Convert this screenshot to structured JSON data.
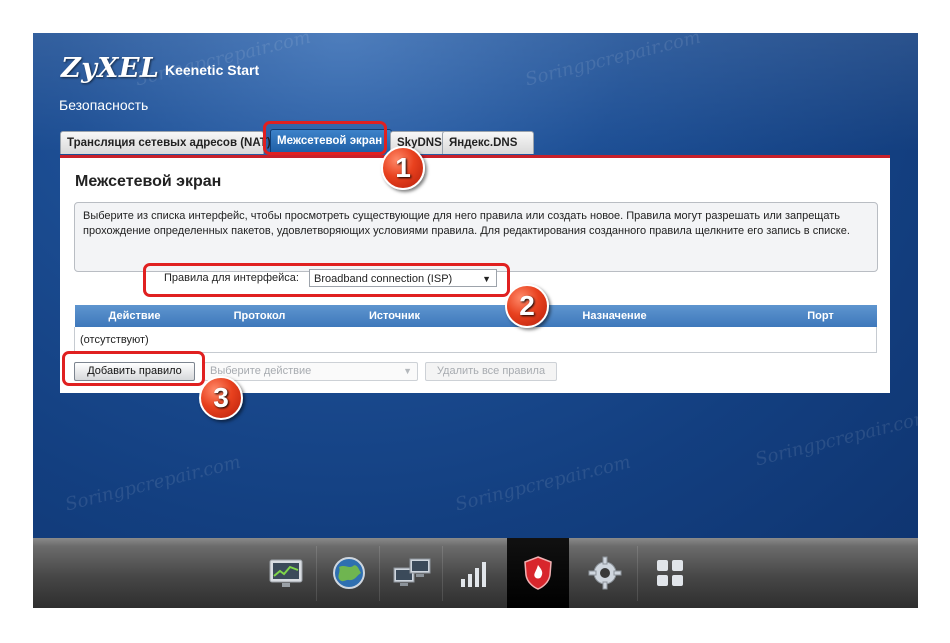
{
  "header": {
    "logo": "ZyXEL",
    "product": "Keenetic Start",
    "section_title": "Безопасность"
  },
  "tabs": [
    {
      "label": "Трансляция сетевых адресов (NAT)",
      "active": false
    },
    {
      "label": "Межсетевой экран",
      "active": true
    },
    {
      "label": "SkyDNS",
      "active": false
    },
    {
      "label": "Яндекс.DNS",
      "active": false
    }
  ],
  "panel": {
    "title": "Межсетевой экран",
    "info": "Выберите из списка интерфейс, чтобы просмотреть существующие для него правила или создать новое. Правила могут разрешать или запрещать прохождение определенных пакетов, удовлетворяющих условиями правила. Для редактирования созданного правила щелкните его запись в списке.",
    "interface_label": "Правила для интерфейса:",
    "interface_value": "Broadband connection (ISP)",
    "table": {
      "columns": [
        "Действие",
        "Протокол",
        "Источник",
        "Назначение",
        "Порт"
      ],
      "empty_text": "(отсутствуют)"
    },
    "add_button": "Добавить правило",
    "action_placeholder": "Выберите действие",
    "delete_all_button": "Удалить все правила"
  },
  "callouts": [
    "1",
    "2",
    "3"
  ],
  "dock": [
    {
      "icon": "monitor-chart-icon",
      "active": false
    },
    {
      "icon": "globe-icon",
      "active": false
    },
    {
      "icon": "network-computers-icon",
      "active": false
    },
    {
      "icon": "signal-bars-icon",
      "active": false
    },
    {
      "icon": "security-shield-icon",
      "active": true
    },
    {
      "icon": "gear-icon",
      "active": false
    },
    {
      "icon": "apps-grid-icon",
      "active": false
    }
  ],
  "watermark": "Soringpcrepair.com",
  "colors": {
    "background_blue": "#1d4f95",
    "accent_red": "#c8202a",
    "tab_active": "#2a6db6",
    "callout_red": "#e02020"
  }
}
